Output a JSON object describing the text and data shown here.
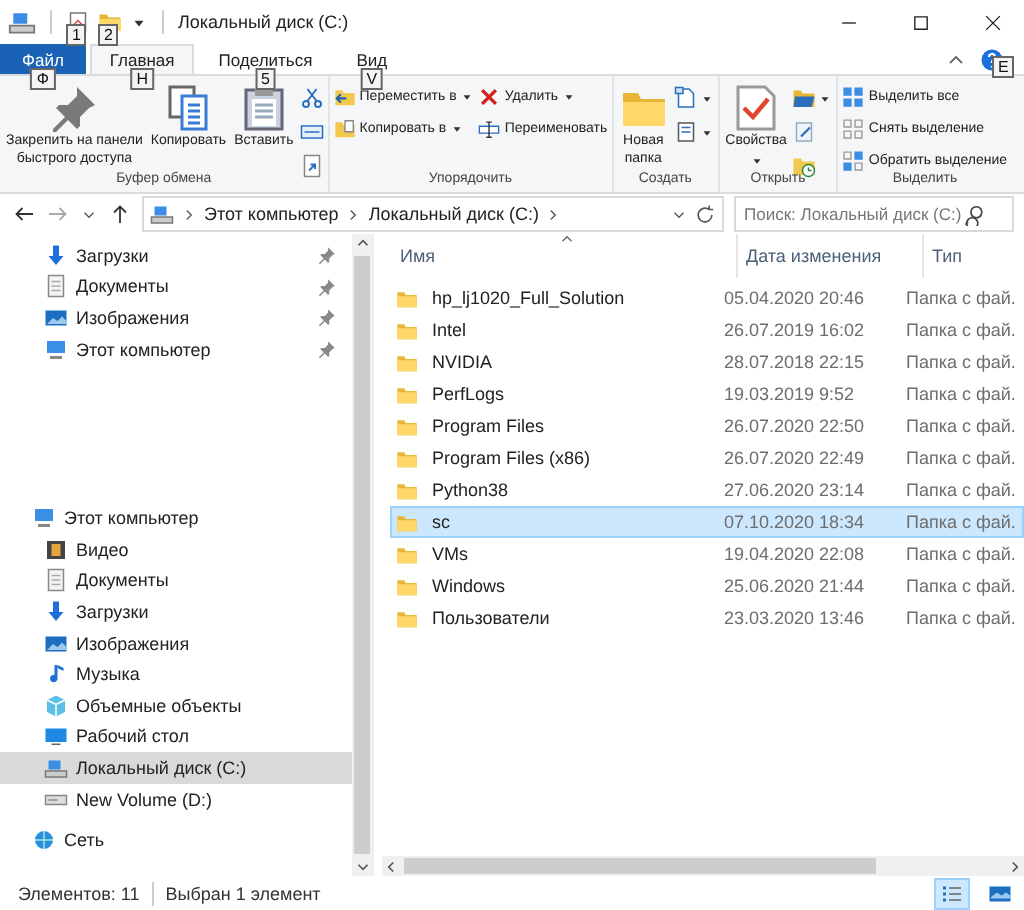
{
  "title_bar": {
    "title": "Локальный диск (C:)",
    "quick_access_keytips": [
      "1",
      "2"
    ]
  },
  "ribbon": {
    "tabs": [
      {
        "label": "Файл",
        "kind": "file",
        "selected": false,
        "keytip": "Ф"
      },
      {
        "label": "Главная",
        "kind": "tab",
        "selected": true,
        "keytip": "H"
      },
      {
        "label": "Поделиться",
        "kind": "tab",
        "selected": false,
        "keytip": "5"
      },
      {
        "label": "Вид",
        "kind": "tab",
        "selected": false,
        "keytip": "V"
      }
    ],
    "help_keytip": "E",
    "groups": [
      {
        "label": "Буфер обмена",
        "columns": [
          {
            "kind": "large",
            "items": [
              {
                "kind": "pin",
                "label": "Закрепить на панели\nбыстрого доступа"
              }
            ]
          },
          {
            "kind": "large",
            "items": [
              {
                "kind": "copy",
                "label": "Копировать"
              }
            ]
          },
          {
            "kind": "large",
            "items": [
              {
                "kind": "paste",
                "label": "Вставить"
              }
            ]
          },
          {
            "kind": "icons",
            "items": [
              {
                "kind": "cut"
              },
              {
                "kind": "copypath"
              },
              {
                "kind": "shortcut"
              }
            ]
          }
        ]
      },
      {
        "label": "Упорядочить",
        "columns": [
          {
            "kind": "small",
            "items": [
              {
                "kind": "move",
                "label": "Переместить в",
                "dropdown": true
              },
              {
                "kind": "copyto",
                "label": "Копировать в",
                "dropdown": true
              }
            ]
          },
          {
            "kind": "small",
            "items": [
              {
                "kind": "delete",
                "label": "Удалить",
                "dropdown": true
              },
              {
                "kind": "rename",
                "label": "Переименовать"
              }
            ]
          }
        ]
      },
      {
        "label": "Создать",
        "columns": [
          {
            "kind": "large",
            "items": [
              {
                "kind": "folder",
                "label": "Новая\nпапка"
              }
            ]
          },
          {
            "kind": "icons",
            "items": [
              {
                "kind": "newitem",
                "dropdown": true
              },
              {
                "kind": "easyaccess",
                "dropdown": true
              }
            ]
          }
        ]
      },
      {
        "label": "Открыть",
        "columns": [
          {
            "kind": "large",
            "items": [
              {
                "kind": "properties",
                "label": "Свойства",
                "dropdown": true
              }
            ]
          },
          {
            "kind": "icons",
            "items": [
              {
                "kind": "open",
                "dropdown": true
              },
              {
                "kind": "edit"
              },
              {
                "kind": "history"
              }
            ]
          }
        ]
      },
      {
        "label": "Выделить",
        "columns": [
          {
            "kind": "small",
            "items": [
              {
                "kind": "selectall",
                "label": "Выделить все"
              },
              {
                "kind": "selectnone",
                "label": "Снять выделение"
              },
              {
                "kind": "invert",
                "label": "Обратить выделение"
              }
            ]
          }
        ]
      }
    ]
  },
  "address_bar": {
    "path": [
      "Этот компьютер",
      "Локальный диск (C:)"
    ],
    "search": {
      "placeholder": "Поиск: Локальный диск (C:)"
    }
  },
  "nav": {
    "quick_access": [
      {
        "label": "Загрузки",
        "kind": "downloads",
        "pinned": true,
        "selected": false
      },
      {
        "label": "Документы",
        "kind": "documents",
        "pinned": true,
        "selected": false
      },
      {
        "label": "Изображения",
        "kind": "pictures",
        "pinned": true,
        "selected": false
      },
      {
        "label": "Этот компьютер",
        "kind": "pc",
        "pinned": true,
        "selected": false
      }
    ],
    "tree": [
      {
        "label": "Этот компьютер",
        "kind": "pc",
        "selected": false,
        "children": [
          {
            "label": "Видео",
            "kind": "video",
            "selected": false
          },
          {
            "label": "Документы",
            "kind": "documents",
            "selected": false
          },
          {
            "label": "Загрузки",
            "kind": "downloads",
            "selected": false
          },
          {
            "label": "Изображения",
            "kind": "pictures",
            "selected": false
          },
          {
            "label": "Музыка",
            "kind": "music",
            "selected": false
          },
          {
            "label": "Объемные объекты",
            "kind": "objects",
            "selected": false
          },
          {
            "label": "Рабочий стол",
            "kind": "desktop",
            "selected": false
          },
          {
            "label": "Локальный диск (C:)",
            "kind": "disk",
            "selected": true
          },
          {
            "label": "New Volume (D:)",
            "kind": "drive",
            "selected": false
          }
        ]
      },
      {
        "label": "Сеть",
        "kind": "network",
        "selected": false
      }
    ]
  },
  "file_list": {
    "columns": [
      "Имя",
      "Дата изменения",
      "Тип"
    ],
    "rows": [
      {
        "name": "hp_lj1020_Full_Solution",
        "date": "05.04.2020 20:46",
        "type": "Папка с фай.",
        "selected": false
      },
      {
        "name": "Intel",
        "date": "26.07.2019 16:02",
        "type": "Папка с фай.",
        "selected": false
      },
      {
        "name": "NVIDIA",
        "date": "28.07.2018 22:15",
        "type": "Папка с фай.",
        "selected": false
      },
      {
        "name": "PerfLogs",
        "date": "19.03.2019 9:52",
        "type": "Папка с фай.",
        "selected": false
      },
      {
        "name": "Program Files",
        "date": "26.07.2020 22:50",
        "type": "Папка с фай.",
        "selected": false
      },
      {
        "name": "Program Files (x86)",
        "date": "26.07.2020 22:49",
        "type": "Папка с фай.",
        "selected": false
      },
      {
        "name": "Python38",
        "date": "27.06.2020 23:14",
        "type": "Папка с фай.",
        "selected": false
      },
      {
        "name": "sc",
        "date": "07.10.2020 18:34",
        "type": "Папка с фай.",
        "selected": true
      },
      {
        "name": "VMs",
        "date": "19.04.2020 22:08",
        "type": "Папка с фай.",
        "selected": false
      },
      {
        "name": "Windows",
        "date": "25.06.2020 21:44",
        "type": "Папка с фай.",
        "selected": false
      },
      {
        "name": "Пользователи",
        "date": "23.03.2020 13:46",
        "type": "Папка с фай.",
        "selected": false
      }
    ]
  },
  "status_bar": {
    "count": "Элементов: 11",
    "selection": "Выбран 1 элемент",
    "views": [
      {
        "kind": "details",
        "selected": true
      },
      {
        "kind": "tiles",
        "selected": false
      }
    ]
  }
}
